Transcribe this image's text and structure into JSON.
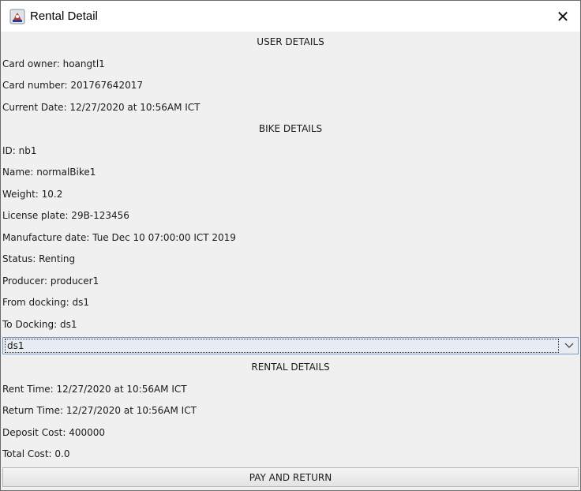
{
  "window": {
    "title": "Rental Detail",
    "close_symbol": "✕",
    "app_icon": "java-app-icon"
  },
  "user_details": {
    "heading": "USER DETAILS",
    "card_owner": "Card owner: hoangtl1",
    "card_number": "Card number: 201767642017",
    "current_date": "Current Date: 12/27/2020 at 10:56AM ICT"
  },
  "bike_details": {
    "heading": "BIKE DETAILS",
    "id": "ID: nb1",
    "name": "Name: normalBike1",
    "weight": "Weight: 10.2",
    "license_plate": "License plate: 29B-123456",
    "manufacture_date": "Manufacture date: Tue Dec 10 07:00:00 ICT 2019",
    "status": "Status: Renting",
    "producer": "Producer: producer1",
    "from_docking": "From docking: ds1",
    "to_docking": "To Docking: ds1"
  },
  "docking_select": {
    "selected": "ds1",
    "arrow_icon": "chevron-down-icon"
  },
  "rental_details": {
    "heading": "RENTAL DETAILS",
    "rent_time": "Rent Time: 12/27/2020 at 10:56AM ICT",
    "return_time": "Return Time: 12/27/2020 at 10:56AM ICT",
    "deposit_cost": "Deposit Cost: 400000",
    "total_cost": "Total Cost: 0.0"
  },
  "actions": {
    "pay_and_return": "PAY AND RETURN"
  }
}
